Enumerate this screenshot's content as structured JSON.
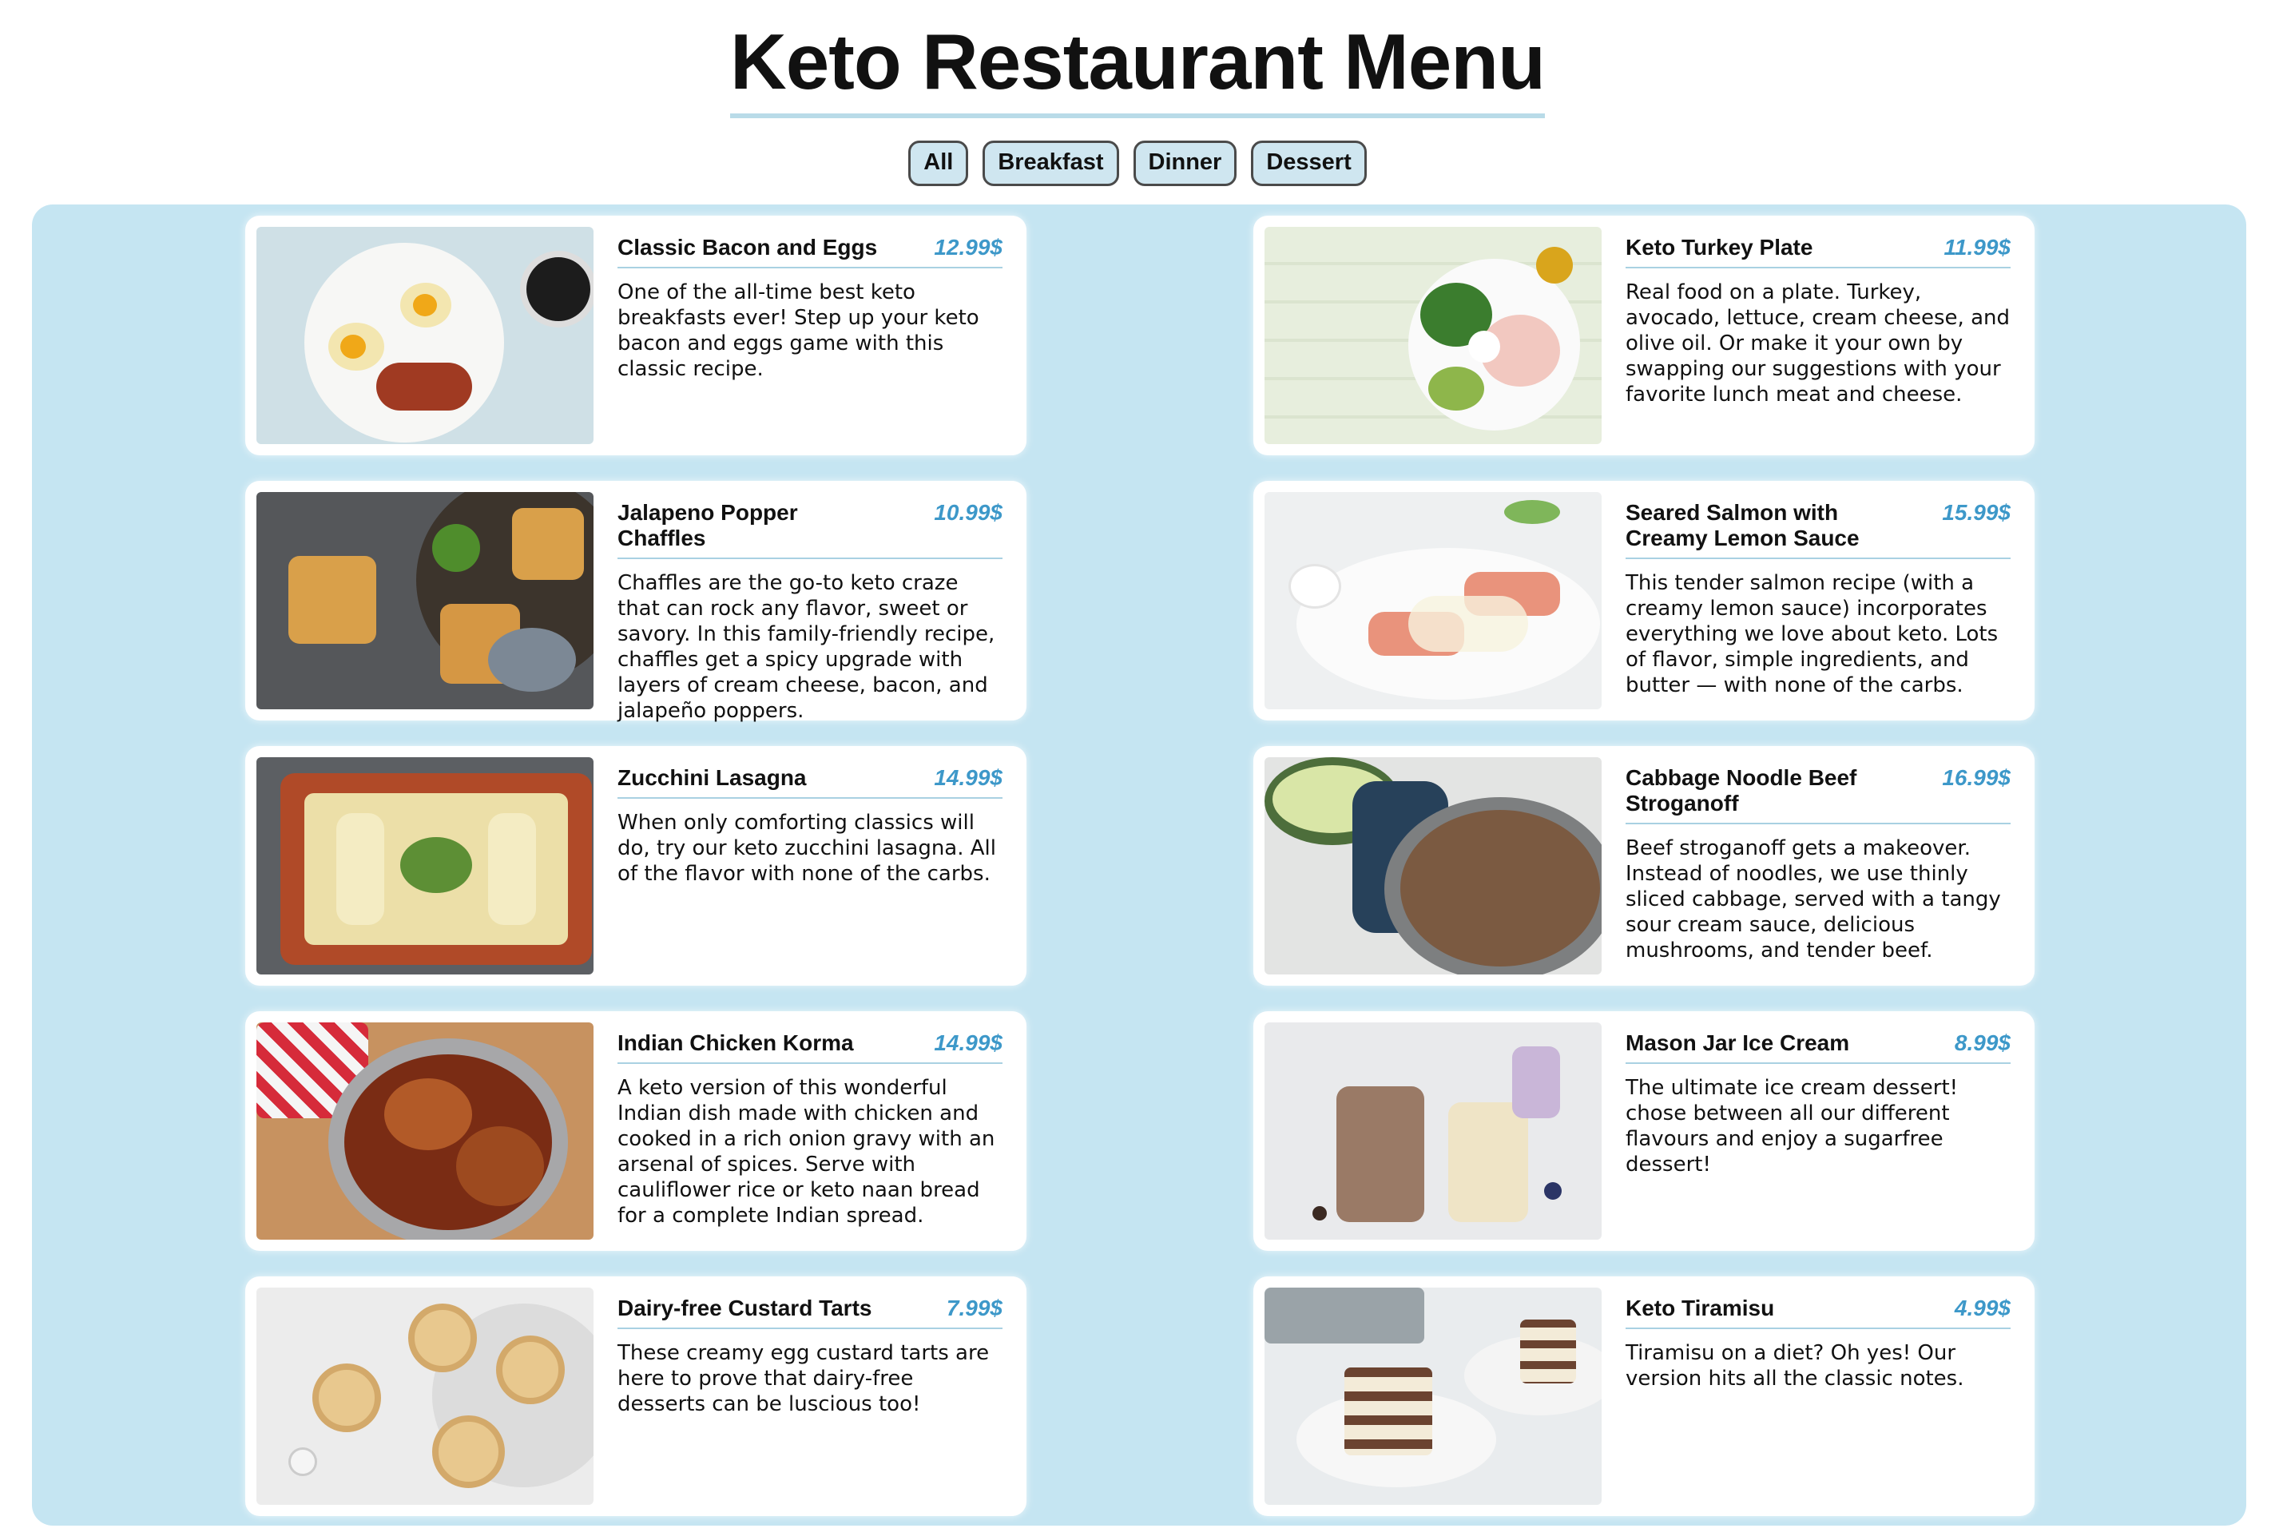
{
  "page": {
    "title": "Keto Restaurant Menu"
  },
  "filters": [
    {
      "label": "All"
    },
    {
      "label": "Breakfast"
    },
    {
      "label": "Dinner"
    },
    {
      "label": "Dessert"
    }
  ],
  "items": [
    {
      "name": "Classic Bacon and Eggs",
      "price": "12.99$",
      "description": "One of the all-time best keto breakfasts ever! Step up your keto bacon and eggs game with this classic recipe.",
      "image": "bacon-eggs-photo"
    },
    {
      "name": "Keto Turkey Plate",
      "price": "11.99$",
      "description": "Real food on a plate. Turkey, avocado, lettuce, cream cheese, and olive oil. Or make it your own by swapping our suggestions with your favorite lunch meat and cheese.",
      "image": "turkey-plate-photo"
    },
    {
      "name": "Jalapeno Popper Chaffles",
      "price": "10.99$",
      "description": "Chaffles are the go-to keto craze that can rock any flavor, sweet or savory. In this family-friendly recipe, chaffles get a spicy upgrade with layers of cream cheese, bacon, and jalapeño poppers.",
      "image": "chaffles-photo"
    },
    {
      "name": "Seared Salmon with Creamy Lemon Sauce",
      "price": "15.99$",
      "description": "This tender salmon recipe (with a creamy lemon sauce) incorporates everything we love about keto. Lots of flavor, simple ingredients, and butter — with none of the carbs.",
      "image": "salmon-photo"
    },
    {
      "name": "Zucchini Lasagna",
      "price": "14.99$",
      "description": "When only comforting classics will do, try our keto zucchini lasagna. All of the flavor with none of the carbs.",
      "image": "lasagna-photo"
    },
    {
      "name": "Cabbage Noodle Beef Stroganoff",
      "price": "16.99$",
      "description": "Beef stroganoff gets a makeover. Instead of noodles, we use thinly sliced cabbage, served with a tangy sour cream sauce, delicious mushrooms, and tender beef.",
      "image": "stroganoff-photo"
    },
    {
      "name": "Indian Chicken Korma",
      "price": "14.99$",
      "description": "A keto version of this wonderful Indian dish made with chicken and cooked in a rich onion gravy with an arsenal of spices. Serve with cauliflower rice or keto naan bread for a complete Indian spread.",
      "image": "korma-photo"
    },
    {
      "name": "Mason Jar Ice Cream",
      "price": "8.99$",
      "description": "The ultimate ice cream dessert! chose between all our different flavours and enjoy a sugarfree dessert!",
      "image": "ice-cream-photo"
    },
    {
      "name": "Dairy-free Custard Tarts",
      "price": "7.99$",
      "description": "These creamy egg custard tarts are here to prove that dairy-free desserts can be luscious too!",
      "image": "custard-tarts-photo"
    },
    {
      "name": "Keto Tiramisu",
      "price": "4.99$",
      "description": "Tiramisu on a diet? Oh yes! Our version hits all the classic notes.",
      "image": "tiramisu-photo"
    }
  ],
  "colors": {
    "panel": "#c5e5f2",
    "price": "#3d98c9",
    "accent_line": "#b9dbe8",
    "filter_bg": "#cfe6f0"
  }
}
